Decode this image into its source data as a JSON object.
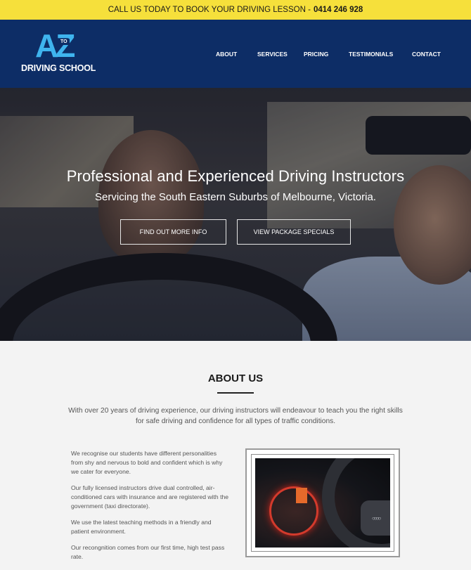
{
  "topbar": {
    "text": "CALL US TODAY TO BOOK YOUR DRIVING LESSON -",
    "phone": "0414 246 928"
  },
  "logo": {
    "letters": "AZ",
    "small": "TO",
    "name": "DRIVING SCHOOL"
  },
  "nav": {
    "items": [
      "ABOUT",
      "SERVICES",
      "PRICING",
      "TESTIMONIALS",
      "CONTACT"
    ]
  },
  "hero": {
    "title": "Professional and Experienced Driving Instructors",
    "subtitle": "Servicing the South Eastern Suburbs of Melbourne, Victoria.",
    "buttons": [
      "FIND OUT MORE INFO",
      "VIEW PACKAGE SPECIALS"
    ]
  },
  "about": {
    "title": "ABOUT US",
    "intro": "With over 20 years of driving experience, our driving instructors will endeavour to teach you the right skills for safe driving and confidence for all types of traffic conditions.",
    "paragraphs": [
      "We recognise our students have different personalities from shy and nervous to bold and confident which is why we cater for everyone.",
      "Our fully licensed instructors drive dual controlled, air-conditioned cars with insurance and are registered with the government (taxi directorate).",
      "We use the latest teaching methods in a friendly and patient environment.",
      "Our recongnition comes from our first time, high test pass rate."
    ]
  },
  "colors": {
    "topbar": "#f6e03b",
    "header": "#0d2d66",
    "logo_accent": "#3fb4ee"
  }
}
